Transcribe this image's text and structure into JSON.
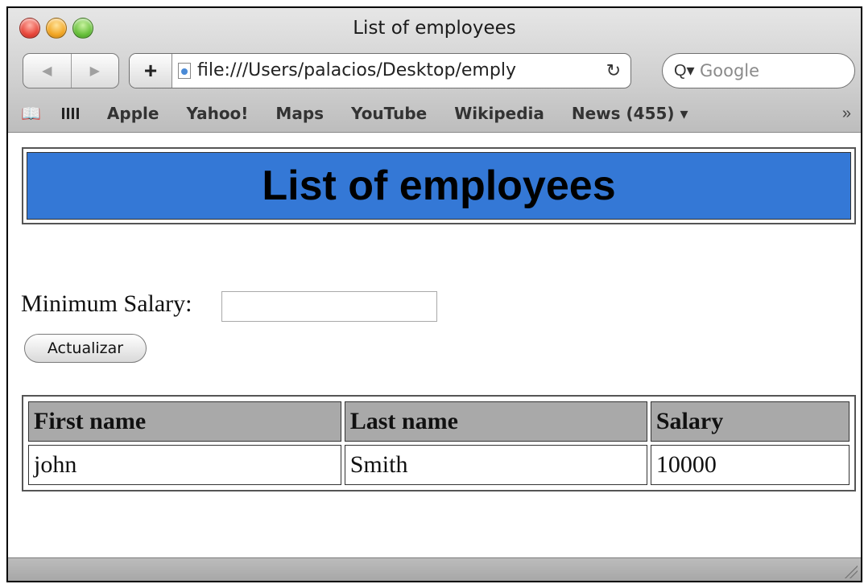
{
  "window": {
    "title": "List of employees"
  },
  "toolbar": {
    "back_icon": "back-arrow",
    "forward_icon": "forward-arrow",
    "add_label": "+",
    "url": "file:///Users/palacios/Desktop/emply",
    "reload_glyph": "↻",
    "search_placeholder": "Google",
    "search_icon_glyph": "Q▾"
  },
  "bookmarks": {
    "items": [
      "Apple",
      "Yahoo!",
      "Maps",
      "YouTube",
      "Wikipedia",
      "News (455) ▾"
    ],
    "more_glyph": "»"
  },
  "page": {
    "heading": "List of employees",
    "heading_bg": "#3478d6",
    "filter_label": "Minimum Salary:",
    "filter_value": "",
    "submit_label": "Actualizar",
    "table": {
      "headers": [
        "First name",
        "Last name",
        "Salary"
      ],
      "header_bg": "#a9a9a9",
      "rows": [
        [
          "john",
          "Smith",
          "10000"
        ]
      ]
    }
  }
}
